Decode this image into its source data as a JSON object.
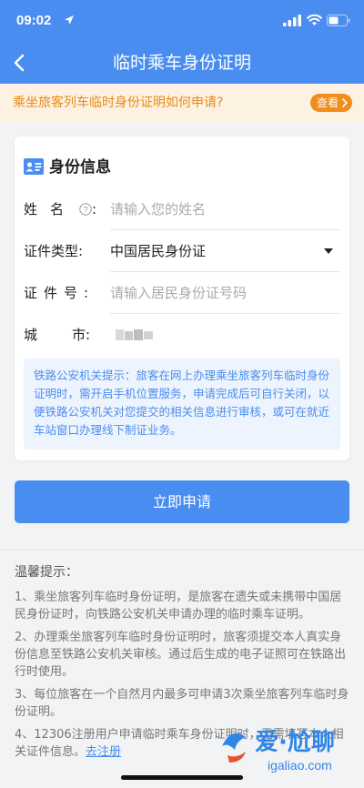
{
  "status_bar": {
    "time": "09:02",
    "icons": [
      "location-arrow-icon",
      "signal-icon",
      "wifi-icon",
      "battery-icon"
    ]
  },
  "nav": {
    "title": "临时乘车身份证明",
    "back_icon": "chevron-left-icon"
  },
  "banner": {
    "text": "乘坐旅客列车临时身份证明如何申请?",
    "button_label": "查看"
  },
  "card": {
    "title": "身份信息",
    "icon": "id-card-icon",
    "fields": [
      {
        "label": "姓    名",
        "suffix": ":",
        "placeholder": "请输入您的姓名",
        "value": ""
      },
      {
        "label": "证件类型:",
        "value": "中国居民身份证"
      },
      {
        "label": "证 件 号:",
        "placeholder": "请输入居民身份证号码",
        "value": ""
      },
      {
        "label": "城      市:",
        "value": ""
      }
    ],
    "notice": "铁路公安机关提示：旅客在网上办理乘坐旅客列车临时身份证明时，需开启手机位置服务，申请完成后可自行关闭，以便铁路公安机关对您提交的相关信息进行审核，或可在就近车站窗口办理线下制证业务。"
  },
  "submit_label": "立即申请",
  "tips": {
    "title": "温馨提示：",
    "items": [
      "1、乘坐旅客列车临时身份证明，是旅客在遗失或未携带中国居民身份证时，向铁路公安机关申请办理的临时乘车证明。",
      "2、办理乘坐旅客列车临时身份证明时，旅客须提交本人真实身份信息至铁路公安机关审核。通过后生成的电子证照可在铁路出行时使用。",
      "3、每位旅客在一个自然月内最多可申请3次乘坐旅客列车临时身份证明。"
    ],
    "item4_text": "4、12306注册用户申请临时乘车身份证明时，无需填写本人相关证件信息。",
    "item4_link": "去注册"
  },
  "watermark": {
    "text": "爱·尬聊",
    "url": "igaliao.com"
  },
  "colors": {
    "primary": "#4a8df0",
    "banner_bg": "#fdf2e1",
    "banner_text": "#e88a1c",
    "banner_button": "#f08d1c",
    "notice_bg": "#eef4fd"
  }
}
